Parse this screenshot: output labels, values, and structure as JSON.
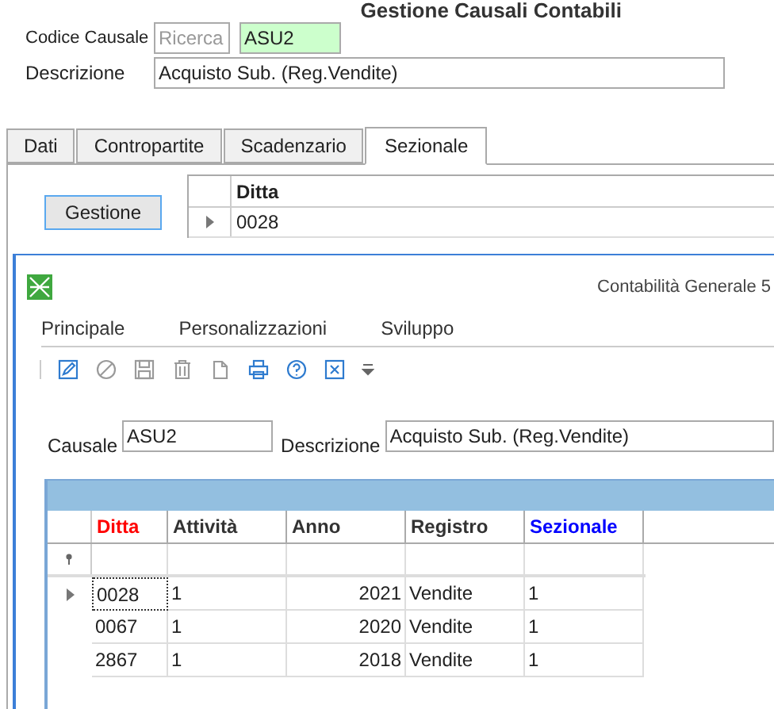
{
  "page_title": "Gestione Causali Contabili",
  "form": {
    "code_label": "Codice Causale",
    "search_placeholder": "Ricerca",
    "code_value": "ASU2",
    "description_label": "Descrizione",
    "description_value": "Acquisto Sub. (Reg.Vendite)"
  },
  "tabs": [
    {
      "label": "Dati",
      "selected": false
    },
    {
      "label": "Contropartite",
      "selected": false
    },
    {
      "label": "Scadenzario",
      "selected": false
    },
    {
      "label": "Sezionale",
      "selected": true
    }
  ],
  "gestione_button": "Gestione",
  "background_grid": {
    "column": "Ditta",
    "rows": [
      "0028"
    ]
  },
  "dialog": {
    "title": "Contabilità Generale 5",
    "menu": [
      {
        "label": "Principale"
      },
      {
        "label": "Personalizzazioni"
      },
      {
        "label": "Sviluppo"
      }
    ],
    "toolbar": [
      {
        "kind": "edit",
        "disabled": false
      },
      {
        "kind": "cancel",
        "disabled": true
      },
      {
        "kind": "save",
        "disabled": true
      },
      {
        "kind": "delete",
        "disabled": true
      },
      {
        "kind": "copy",
        "disabled": true
      },
      {
        "kind": "print",
        "disabled": false
      },
      {
        "kind": "help",
        "disabled": false
      },
      {
        "kind": "close",
        "disabled": false
      },
      {
        "kind": "more",
        "disabled": false
      }
    ],
    "causale_label": "Causale",
    "causale_value": "ASU2",
    "descrizione_label": "Descrizione",
    "descrizione_value": "Acquisto Sub. (Reg.Vendite)",
    "grid": {
      "columns": [
        {
          "label": "Ditta",
          "color": "#ff0000"
        },
        {
          "label": "Attività",
          "color": "#333333"
        },
        {
          "label": "Anno",
          "color": "#333333"
        },
        {
          "label": "Registro",
          "color": "#333333"
        },
        {
          "label": "Sezionale",
          "color": "#0000ff"
        }
      ],
      "rows": [
        {
          "cells": [
            "0028",
            "1",
            "2021",
            "Vendite",
            "1"
          ],
          "current": true
        },
        {
          "cells": [
            "0067",
            "1",
            "2020",
            "Vendite",
            "1"
          ],
          "current": false
        },
        {
          "cells": [
            "2867",
            "1",
            "2018",
            "Vendite",
            "1"
          ],
          "current": false
        }
      ]
    }
  }
}
